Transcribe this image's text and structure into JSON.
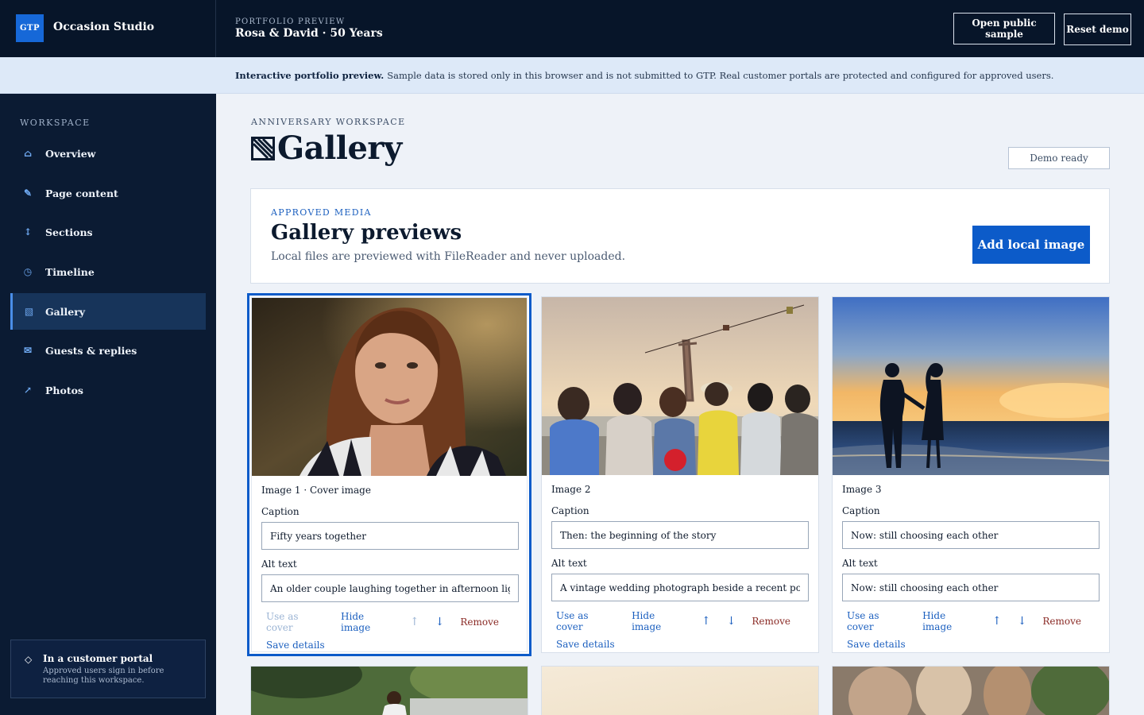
{
  "topbar": {
    "logo": "GTP",
    "brand": "Occasion Studio",
    "eyebrow": "PORTFOLIO PREVIEW",
    "title": "Rosa & David · 50 Years",
    "open_sample": "Open public sample",
    "reset": "Reset demo"
  },
  "notice": {
    "strong": "Interactive portfolio preview.",
    "text": "Sample data is stored only in this browser and is not submitted to GTP. Real customer portals are protected and configured for approved users."
  },
  "sidebar": {
    "heading": "WORKSPACE",
    "items": [
      {
        "label": "Overview",
        "icon": "home-icon",
        "glyph": "⌂"
      },
      {
        "label": "Page content",
        "icon": "pen-icon",
        "glyph": "✎"
      },
      {
        "label": "Sections",
        "icon": "reorder-icon",
        "glyph": "↕"
      },
      {
        "label": "Timeline",
        "icon": "clock-icon",
        "glyph": "◷"
      },
      {
        "label": "Gallery",
        "icon": "gallery-icon",
        "glyph": "▧"
      },
      {
        "label": "Guests & replies",
        "icon": "mail-icon",
        "glyph": "✉"
      },
      {
        "label": "Photos",
        "icon": "external-link-icon",
        "glyph": "↗"
      }
    ],
    "portal_title": "In a customer portal",
    "portal_text": "Approved users sign in before reaching this workspace."
  },
  "main": {
    "eyebrow": "ANNIVERSARY WORKSPACE",
    "title": "Gallery",
    "status": "Demo ready"
  },
  "media": {
    "eyebrow": "APPROVED MEDIA",
    "title": "Gallery previews",
    "description": "Local files are previewed with FileReader and never uploaded.",
    "add_button": "Add local image"
  },
  "labels": {
    "caption": "Caption",
    "alt": "Alt text",
    "use_cover": "Use as cover",
    "hide": "Hide image",
    "up": "↑",
    "down": "↓",
    "remove": "Remove",
    "save": "Save details"
  },
  "cards": [
    {
      "label": "Image 1 · Cover image",
      "caption": "Fifty years together",
      "alt": "An older couple laughing together in afternoon light"
    },
    {
      "label": "Image 2",
      "caption": "Then: the beginning of the story",
      "alt": "A vintage wedding photograph beside a recent portrait"
    },
    {
      "label": "Image 3",
      "caption": "Now: still choosing each other",
      "alt": "Now: still choosing each other"
    }
  ]
}
